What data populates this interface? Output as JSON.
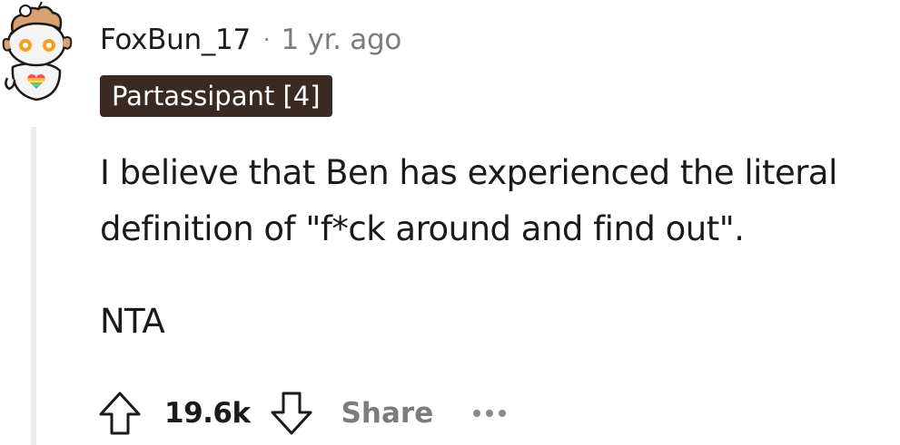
{
  "comment": {
    "author": "FoxBun_17",
    "separator": "·",
    "time": "1 yr. ago",
    "flair": "Partassipant [4]",
    "body": [
      "I believe that Ben has experienced the literal definition of \"f*ck around and find out\".",
      "NTA"
    ]
  },
  "actions": {
    "upvote_icon": "arrow-up-icon",
    "score": "19.6k",
    "downvote_icon": "arrow-down-icon",
    "share_label": "Share",
    "more_icon": "more-options-icon"
  },
  "avatar": {
    "icon": "snoo-avatar-icon",
    "colors": {
      "body": "#f2f2f2",
      "hair": "#d89a6a",
      "eye": "#f7a01e",
      "badge_rainbow": [
        "#ff4d4d",
        "#ffb347",
        "#ffe14d",
        "#66cc66",
        "#4da6ff",
        "#b266ff"
      ]
    }
  }
}
